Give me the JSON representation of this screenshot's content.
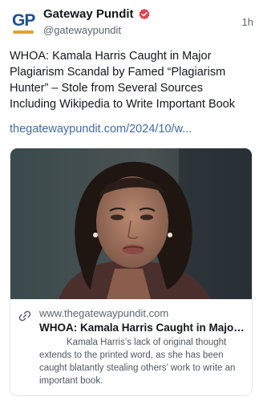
{
  "post": {
    "author_name": "Gateway Pundit",
    "author_handle": "@gatewaypundit",
    "avatar_text": "GP",
    "time_ago": "1h",
    "text": "WHOA: Kamala Harris Caught in Major Plagiarism Scandal by Famed “Plagiarism Hunter” – Stole from Several Sources Including Wikipedia to Write Important Book",
    "link": "thegatewaypundit.com/2024/10/w..."
  },
  "card": {
    "domain": "www.thegatewaypundit.com",
    "title": "WHOA: Kamala Harris Caught in Major...",
    "description": "Kamala Harris’s lack of original thought extends to the printed word, as she has been caught blatantly stealing others’ work to write an important book."
  },
  "icons": {
    "verified": "verified-badge-icon",
    "link": "link-icon"
  },
  "colors": {
    "verified_badge": "#e0434d",
    "link": "#3f6ba8",
    "avatar_text": "#1d4f91",
    "avatar_accent": "#e2a32b"
  }
}
